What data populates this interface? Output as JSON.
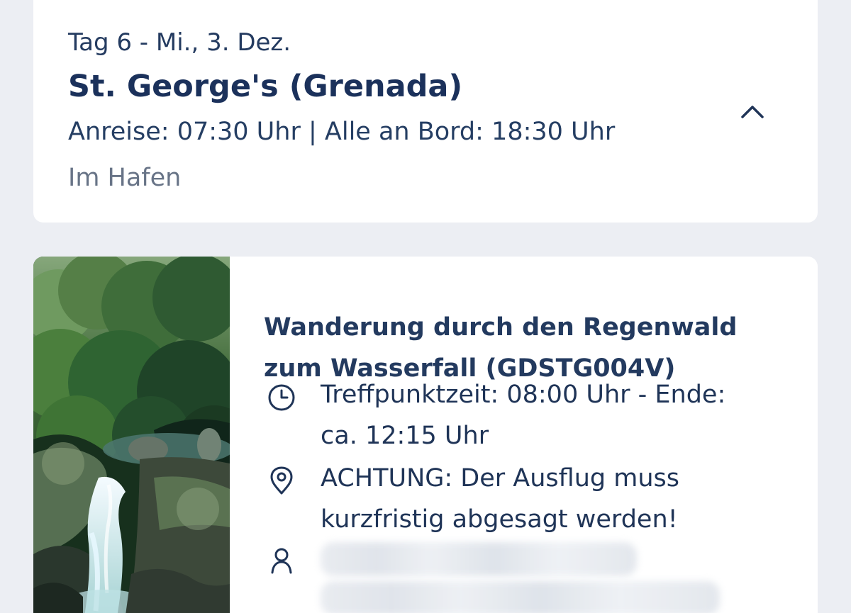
{
  "itinerary": {
    "day_label": "Tag 6 - Mi., 3. Dez.",
    "port_name": "St. George's (Grenada)",
    "times": "Anreise: 07:30 Uhr | Alle an Bord: 18:30 Uhr",
    "status": "Im Hafen",
    "toggle_icon": "chevron-up-icon"
  },
  "excursion": {
    "title": "Wanderung durch den Regenwald\nzum Wasserfall (GDSTG004V)",
    "meeting_time": "Treffpunktzeit: 08:00 Uhr - Ende:\nca. 12:15 Uhr",
    "notice": "ACHTUNG: Der Ausflug muss\nkurzfristig abgesagt werden!",
    "icons": {
      "time": "clock-icon",
      "notice": "location-pin-icon",
      "person": "person-icon"
    }
  },
  "colors": {
    "background": "#eceef3",
    "card": "#ffffff",
    "primary_text": "#1f3457",
    "muted_text": "#687487"
  }
}
